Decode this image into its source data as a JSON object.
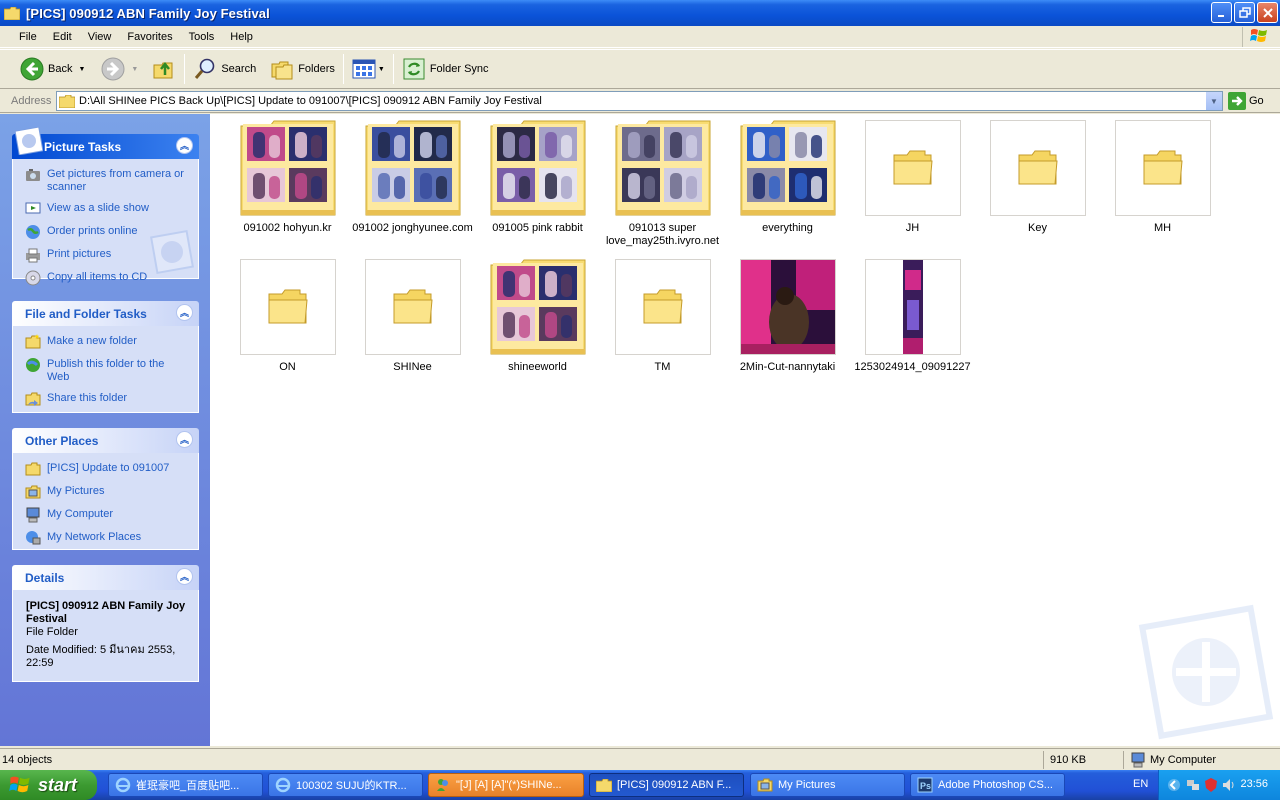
{
  "window": {
    "title": "[PICS] 090912 ABN Family Joy Festival"
  },
  "menu": [
    "File",
    "Edit",
    "View",
    "Favorites",
    "Tools",
    "Help"
  ],
  "toolbar": {
    "back_label": "Back",
    "search_label": "Search",
    "folders_label": "Folders",
    "foldersync_label": "Folder Sync"
  },
  "address": {
    "label": "Address",
    "value": "D:\\All SHINee PICS Back Up\\[PICS] Update to 091007\\[PICS] 090912 ABN Family Joy Festival",
    "go_label": "Go"
  },
  "sidebar": {
    "picture_tasks": {
      "title": "Picture Tasks",
      "items": [
        {
          "label": "Get pictures from camera or scanner",
          "icon": "camera-icon"
        },
        {
          "label": "View as a slide show",
          "icon": "slideshow-icon"
        },
        {
          "label": "Order prints online",
          "icon": "globe-icon"
        },
        {
          "label": "Print pictures",
          "icon": "printer-icon"
        },
        {
          "label": "Copy all items to CD",
          "icon": "cd-icon"
        }
      ]
    },
    "file_folder_tasks": {
      "title": "File and Folder Tasks",
      "items": [
        {
          "label": "Make a new folder",
          "icon": "new-folder-icon"
        },
        {
          "label": "Publish this folder to the Web",
          "icon": "publish-icon"
        },
        {
          "label": "Share this folder",
          "icon": "share-icon"
        }
      ]
    },
    "other_places": {
      "title": "Other Places",
      "items": [
        {
          "label": "[PICS] Update to 091007",
          "icon": "folder-icon"
        },
        {
          "label": "My Pictures",
          "icon": "my-pictures-icon"
        },
        {
          "label": "My Computer",
          "icon": "my-computer-icon"
        },
        {
          "label": "My Network Places",
          "icon": "network-icon"
        }
      ]
    },
    "details": {
      "title": "Details",
      "name": "[PICS] 090912 ABN Family Joy Festival",
      "type": "File Folder",
      "modified": "Date Modified: 5 มีนาคม 2553, 22:59"
    }
  },
  "items": [
    {
      "label": "091002 hohyun.kr",
      "kind": "folder-thumbs"
    },
    {
      "label": "091002 jonghyunee.com",
      "kind": "folder-thumbs"
    },
    {
      "label": "091005 pink rabbit",
      "kind": "folder-thumbs"
    },
    {
      "label": "091013 super love_may25th.ivyro.net",
      "kind": "folder-thumbs"
    },
    {
      "label": "everything",
      "kind": "folder-thumbs"
    },
    {
      "label": "JH",
      "kind": "folder"
    },
    {
      "label": "Key",
      "kind": "folder"
    },
    {
      "label": "MH",
      "kind": "folder"
    },
    {
      "label": "ON",
      "kind": "folder"
    },
    {
      "label": "SHINee",
      "kind": "folder"
    },
    {
      "label": "shineeworld",
      "kind": "folder-thumbs"
    },
    {
      "label": "TM",
      "kind": "folder"
    },
    {
      "label": "2Min-Cut-nannytaki",
      "kind": "image"
    },
    {
      "label": "1253024914_09091227",
      "kind": "image"
    }
  ],
  "status": {
    "count": "14 objects",
    "size": "910 KB",
    "zone": "My Computer"
  },
  "taskbar": {
    "start_label": "start",
    "buttons": [
      {
        "label": "崔珉豪吧_百度贴吧..."
      },
      {
        "label": "100302 SUJU的KTR..."
      },
      {
        "label": "\"[J] [A] [A]\"(*)SHINe..."
      },
      {
        "label": "[PICS] 090912 ABN F..."
      },
      {
        "label": "My Pictures"
      },
      {
        "label": "Adobe Photoshop CS..."
      }
    ],
    "lang": "EN",
    "clock": "23:56"
  }
}
